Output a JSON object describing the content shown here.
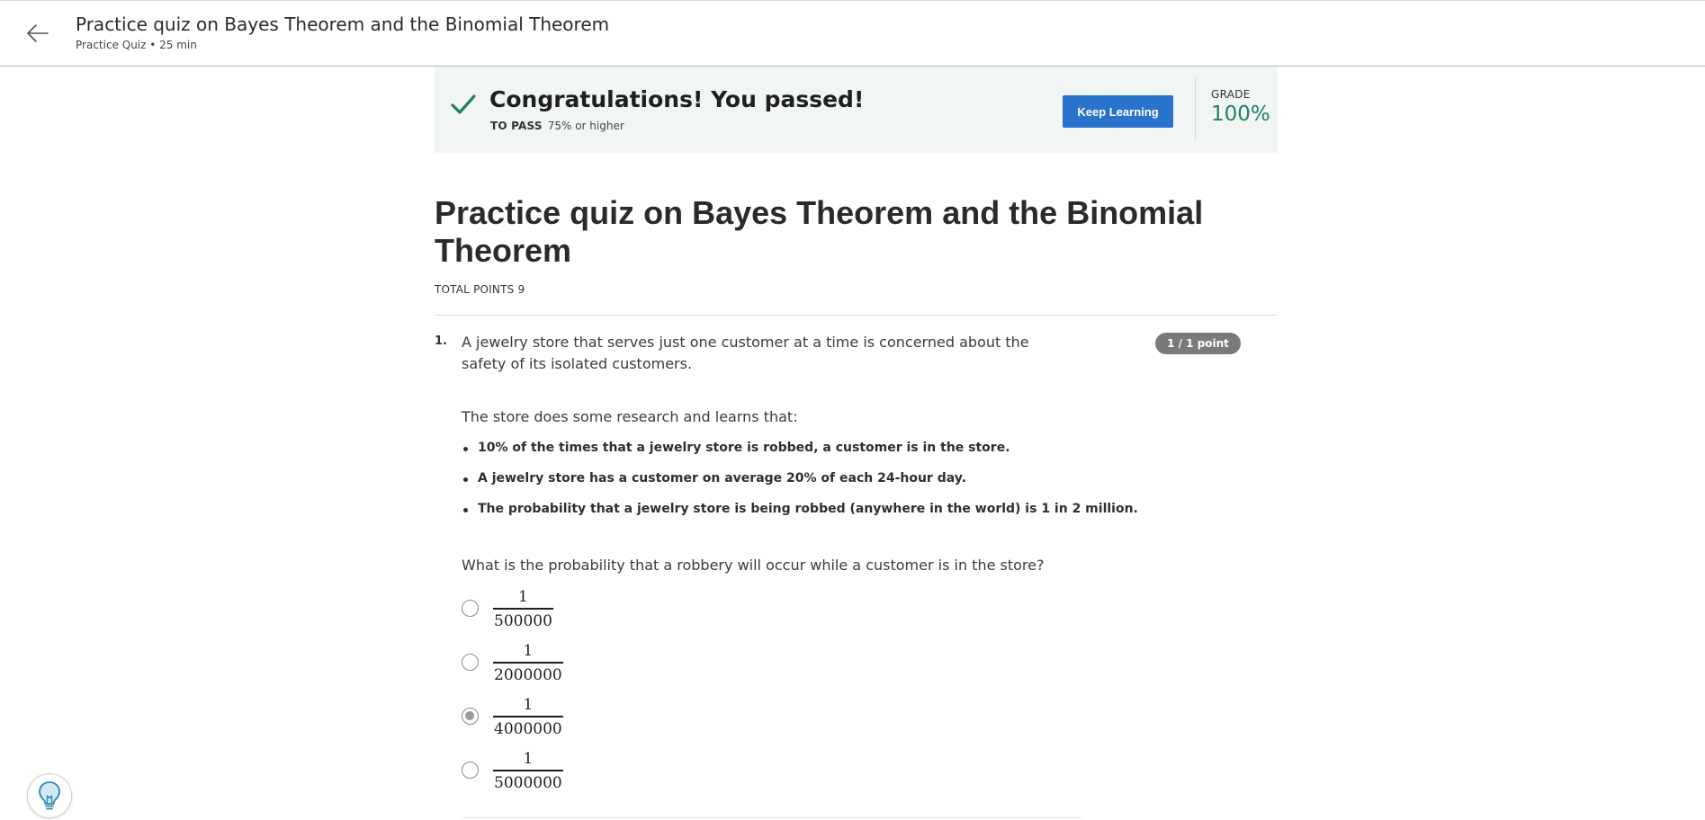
{
  "header": {
    "title": "Practice quiz on Bayes Theorem and the Binomial Theorem",
    "subtitle": "Practice Quiz • 25 min"
  },
  "banner": {
    "message": "Congratulations! You passed!",
    "to_pass_label": "TO PASS",
    "to_pass_value": "75% or higher",
    "keep_learning_label": "Keep Learning",
    "grade_label": "GRADE",
    "grade_value": "100%",
    "accent_color": "#1f8354",
    "button_color": "#2a73cc"
  },
  "quiz": {
    "title": "Practice quiz on Bayes Theorem and the Binomial Theorem",
    "total_points": "TOTAL POINTS 9"
  },
  "question": {
    "number": "1.",
    "points_badge": "1 / 1 point",
    "text": "A jewelry store that serves just one customer at a time is concerned about the safety of its isolated customers.",
    "research_intro": "The store does some research and learns that:",
    "facts": [
      "10% of the times that a jewelry store is robbed, a customer is in the store.",
      "A jewelry store has a customer on average 20% of each 24-hour day.",
      "The probability that a jewelry store is being robbed (anywhere in the world) is 1 in 2 million."
    ],
    "prompt": "What is the probability that a robbery will occur while a customer is in the store?",
    "options": [
      {
        "numerator": "1",
        "denominator": "500000",
        "selected": false
      },
      {
        "numerator": "1",
        "denominator": "2000000",
        "selected": false
      },
      {
        "numerator": "1",
        "denominator": "4000000",
        "selected": true
      },
      {
        "numerator": "1",
        "denominator": "5000000",
        "selected": false
      }
    ]
  },
  "icons": {
    "back": "arrow-left-icon",
    "check": "checkmark-icon",
    "help": "lightbulb-icon"
  }
}
